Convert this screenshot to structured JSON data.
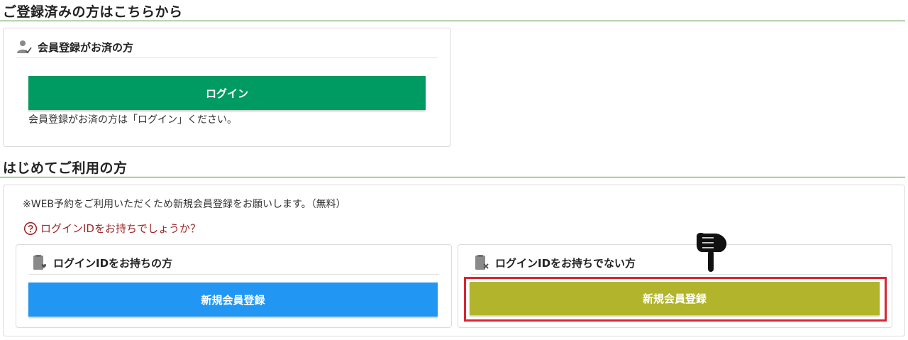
{
  "registered": {
    "section_title": "ご登録済みの方はこちらから",
    "card_title": "会員登録がお済の方",
    "login_button": "ログイン",
    "login_note": "会員登録がお済の方は「ログイン」ください。"
  },
  "first_time": {
    "section_title": "はじめてご利用の方",
    "notice": "※WEB予約をご利用いただくため新規会員登録をお願いします。（無料）",
    "id_help_link": "ログインIDをお持ちでしょうか？",
    "with_id": {
      "card_title": "ログインIDをお持ちの方",
      "button": "新規会員登録"
    },
    "without_id": {
      "card_title": "ログインIDをお持ちでない方",
      "button": "新規会員登録"
    }
  },
  "colors": {
    "login_green": "#009a63",
    "blue_button": "#2196f3",
    "olive_button": "#b2b42c",
    "highlight_red": "#d9252f",
    "section_rule": "#3e8e2f",
    "help_link": "#9b2b2b"
  },
  "icons": {
    "member_check": "user-check-icon",
    "id_with": "id-card-heart-icon",
    "id_without": "id-card-x-icon",
    "help": "question-circle-icon",
    "pointer": "pointing-hand-icon"
  }
}
